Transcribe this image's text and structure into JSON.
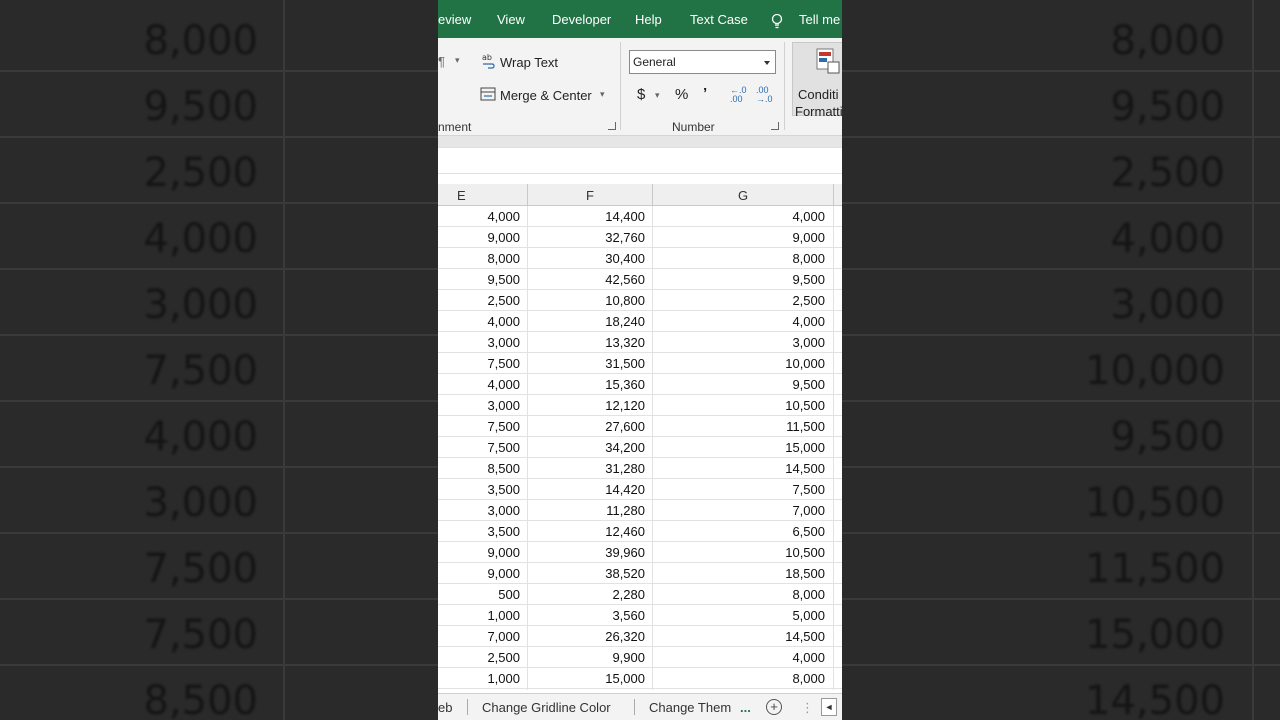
{
  "backdrop": {
    "left": [
      "8,000",
      "9,500",
      "2,500",
      "4,000",
      "3,000",
      "7,500",
      "4,000",
      "3,000",
      "7,500",
      "7,500",
      "8,500"
    ],
    "right": [
      "8,000",
      "9,500",
      "2,500",
      "4,000",
      "3,000",
      "10,000",
      "9,500",
      "10,500",
      "11,500",
      "15,000",
      "14,500"
    ]
  },
  "tabs": [
    "eview",
    "View",
    "Developer",
    "Help",
    "Text Case",
    "Tell me"
  ],
  "ribbon": {
    "paragraph_mark": "¶",
    "wrap_text": "Wrap Text",
    "merge_center": "Merge & Center",
    "alignment_label": "nment",
    "number_format": "General",
    "currency": "$",
    "percent": "%",
    "comma": "’",
    "inc_decimal": "←.0 .00",
    "dec_decimal": ".00 →.0",
    "number_label": "Number",
    "cond_line1": "Conditi",
    "cond_line2": "Formatti"
  },
  "columns": [
    "E",
    "F",
    "G"
  ],
  "rows": [
    [
      "4,000",
      "14,400",
      "4,000"
    ],
    [
      "9,000",
      "32,760",
      "9,000"
    ],
    [
      "8,000",
      "30,400",
      "8,000"
    ],
    [
      "9,500",
      "42,560",
      "9,500"
    ],
    [
      "2,500",
      "10,800",
      "2,500"
    ],
    [
      "4,000",
      "18,240",
      "4,000"
    ],
    [
      "3,000",
      "13,320",
      "3,000"
    ],
    [
      "7,500",
      "31,500",
      "10,000"
    ],
    [
      "4,000",
      "15,360",
      "9,500"
    ],
    [
      "3,000",
      "12,120",
      "10,500"
    ],
    [
      "7,500",
      "27,600",
      "11,500"
    ],
    [
      "7,500",
      "34,200",
      "15,000"
    ],
    [
      "8,500",
      "31,280",
      "14,500"
    ],
    [
      "3,500",
      "14,420",
      "7,500"
    ],
    [
      "3,000",
      "11,280",
      "7,000"
    ],
    [
      "3,500",
      "12,460",
      "6,500"
    ],
    [
      "9,000",
      "39,960",
      "10,500"
    ],
    [
      "9,000",
      "38,520",
      "18,500"
    ],
    [
      "500",
      "2,280",
      "8,000"
    ],
    [
      "1,000",
      "3,560",
      "5,000"
    ],
    [
      "7,000",
      "26,320",
      "14,500"
    ],
    [
      "2,500",
      "9,900",
      "4,000"
    ],
    [
      "1,000",
      "15,000",
      "8,000"
    ]
  ],
  "sheets": {
    "prev": "eb",
    "tab1": "Change Gridline Color",
    "tab2": "Change Them",
    "more": "...",
    "add": "+",
    "menu": "⋮",
    "nav_left": "◄"
  },
  "colors": {
    "excel_green": "#217346",
    "ribbon_bg": "#f3f3f3"
  }
}
